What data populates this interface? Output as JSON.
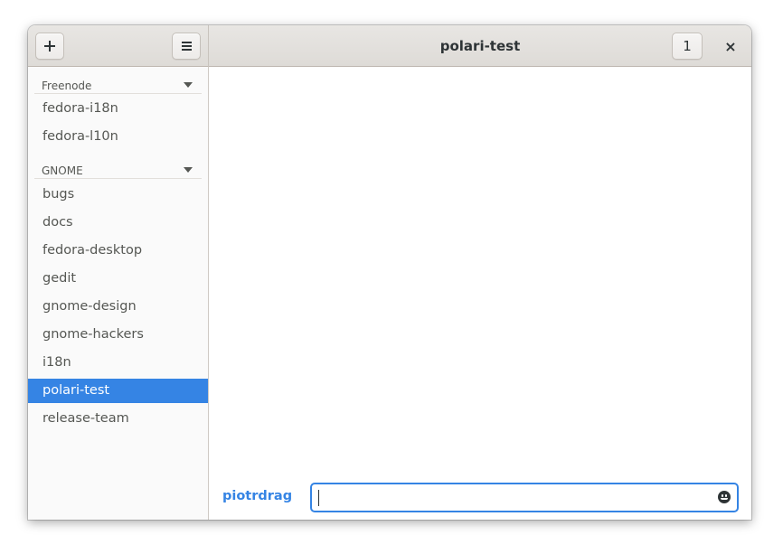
{
  "window": {
    "title": "polari-test"
  },
  "header": {
    "add_button_icon": "plus-icon",
    "menu_button_icon": "hamburger-menu-icon",
    "user_count": "1",
    "close_label": "×"
  },
  "sidebar": {
    "networks": [
      {
        "name": "Freenode",
        "rooms": [
          "fedora-i18n",
          "fedora-l10n"
        ]
      },
      {
        "name": "GNOME",
        "rooms": [
          "bugs",
          "docs",
          "fedora-desktop",
          "gedit",
          "gnome-design",
          "gnome-hackers",
          "i18n",
          "polari-test",
          "release-team"
        ]
      }
    ],
    "selected_room": "polari-test"
  },
  "chat": {
    "nick": "piotrdrag",
    "entry_value": "",
    "entry_placeholder": "",
    "emoji_icon": "emoji-icon"
  },
  "colors": {
    "accent": "#3584e4",
    "headerbar": "#e8e6e3",
    "sidebar_bg": "#fafafa",
    "text": "#555753"
  }
}
